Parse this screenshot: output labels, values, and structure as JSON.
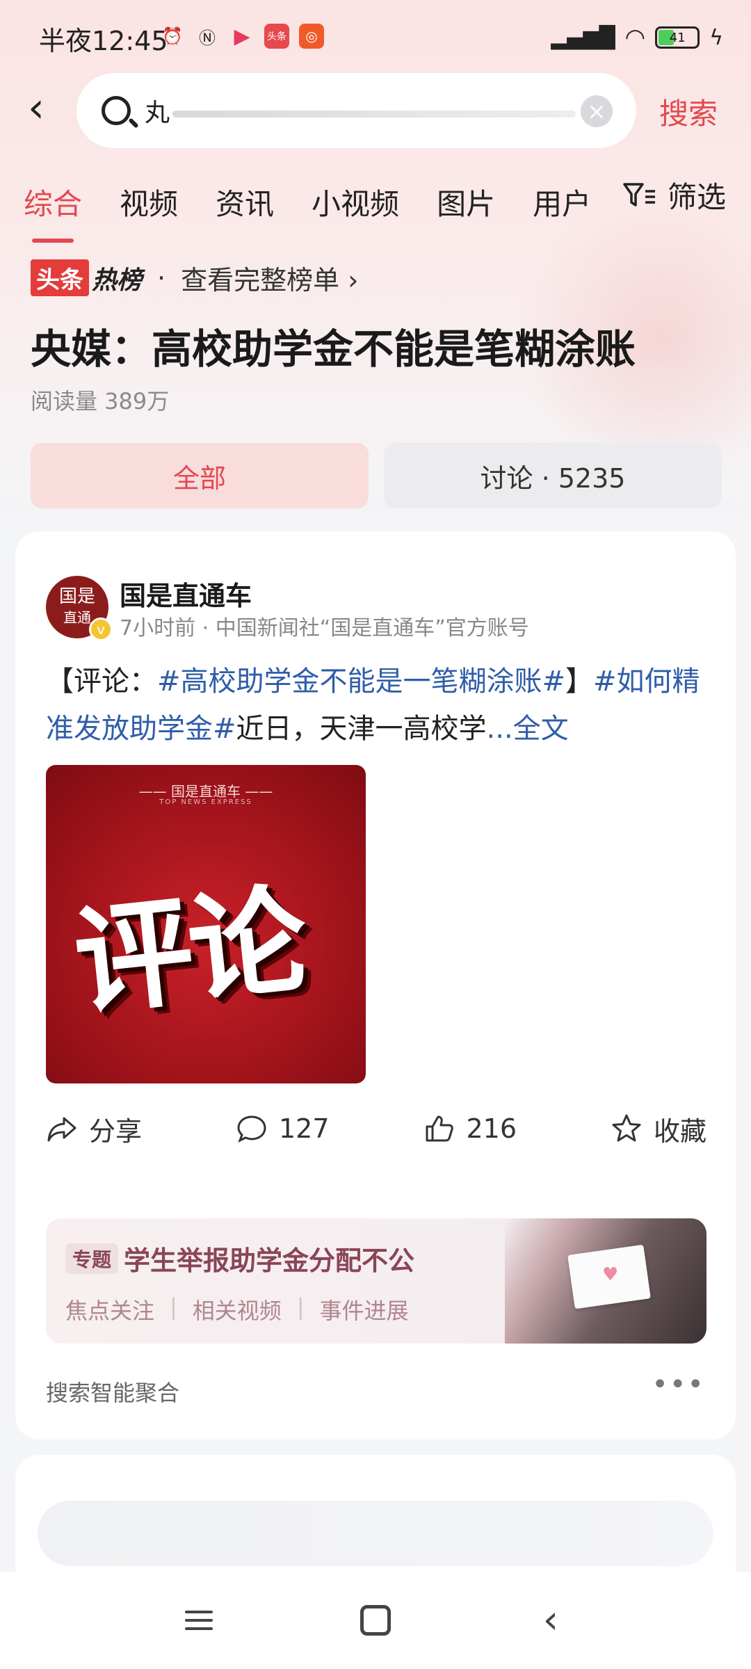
{
  "status_bar": {
    "time": "半夜12:45",
    "battery": "41"
  },
  "search": {
    "query": "丸",
    "button_label": "搜索"
  },
  "tabs": [
    {
      "label": "综合"
    },
    {
      "label": "视频"
    },
    {
      "label": "资讯"
    },
    {
      "label": "小视频"
    },
    {
      "label": "图片"
    },
    {
      "label": "用户"
    }
  ],
  "filter_label": "筛选",
  "hot": {
    "badge": "头条",
    "badge2": "热榜",
    "link": "查看完整榜单 ›",
    "headline": "央媒：高校助学金不能是笔糊涂账",
    "reads": "阅读量 389万"
  },
  "segments": {
    "all": "全部",
    "discussion": "讨论 · 5235"
  },
  "post": {
    "avatar_line1": "国是",
    "avatar_line2": "直通",
    "author": "国是直通车",
    "meta": "7小时前 · 中国新闻社“国是直通车”官方账号",
    "text_prefix": "【评论：",
    "tag1": "#高校助学金不能是一笔糊涂账#",
    "text_mid": "】",
    "tag2": "#如何精准发放助学金#",
    "text_rest": "近日，天津一高校学",
    "more": "...全文",
    "image_brand": "—— 国是直通车 ——",
    "image_brand_sub": "TOP NEWS EXPRESS",
    "image_text": "评论",
    "share": "分享",
    "comments": "127",
    "likes": "216",
    "favorite": "收藏"
  },
  "topic": {
    "tag": "专题",
    "title": "学生举报助学金分配不公",
    "links": [
      "焦点关注",
      "相关视频",
      "事件进展"
    ]
  },
  "aggregation": "搜索智能聚合",
  "colors": {
    "accent": "#e2494f",
    "hashtag": "#2f5da8"
  }
}
